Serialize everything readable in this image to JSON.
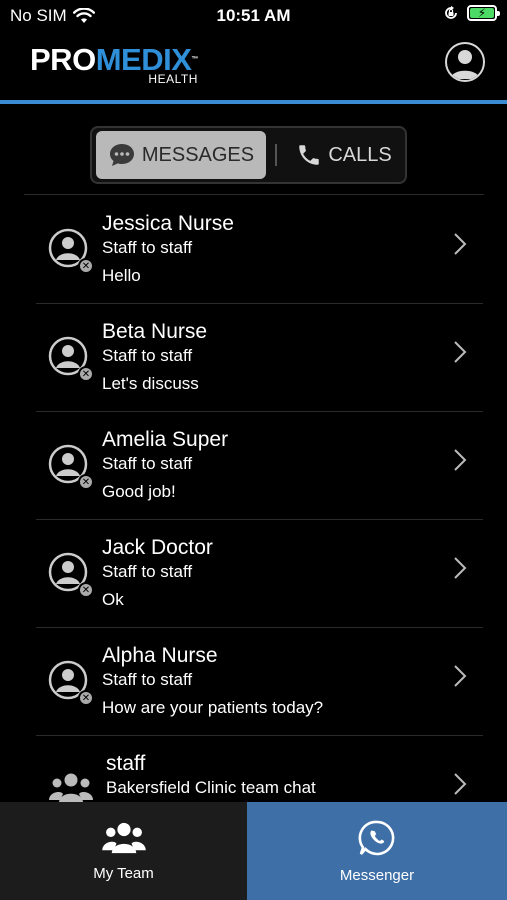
{
  "status_bar": {
    "carrier": "No SIM",
    "time": "10:51 AM",
    "wifi_icon": "wifi-icon",
    "battery_icon": "battery-charging-icon",
    "orientation_lock_icon": "orientation-lock-icon"
  },
  "header": {
    "logo_pro": "PRO",
    "logo_medix": "MEDIX",
    "logo_tm": "™",
    "logo_sub": "HEALTH",
    "profile_icon": "user-circle-icon",
    "divider_color": "#3a8bd1"
  },
  "segmented": {
    "messages_label": "MESSAGES",
    "calls_label": "CALLS",
    "messages_icon": "chat-bubble-icon",
    "calls_icon": "phone-icon",
    "selected": "MESSAGES"
  },
  "conversations": [
    {
      "name": "Jessica Nurse",
      "type": "Staff to staff",
      "message": "Hello",
      "avatar": "user-offline-icon"
    },
    {
      "name": "Beta Nurse",
      "type": "Staff to staff",
      "message": "Let's discuss",
      "avatar": "user-offline-icon"
    },
    {
      "name": "Amelia Super",
      "type": "Staff to staff",
      "message": "Good job!",
      "avatar": "user-offline-icon"
    },
    {
      "name": "Jack Doctor",
      "type": "Staff to staff",
      "message": "Ok",
      "avatar": "user-offline-icon"
    },
    {
      "name": "Alpha Nurse",
      "type": "Staff to staff",
      "message": "How are your patients today?",
      "avatar": "user-offline-icon"
    },
    {
      "name": "staff",
      "type": "Bakersfield Clinic team chat",
      "message": "",
      "avatar": "group-icon"
    }
  ],
  "tab_bar": {
    "tabs": [
      {
        "label": "My Team",
        "icon": "team-icon"
      },
      {
        "label": "Messenger",
        "icon": "whatsapp-chat-icon"
      }
    ],
    "active": "Messenger",
    "active_color": "#3e6fa6"
  }
}
